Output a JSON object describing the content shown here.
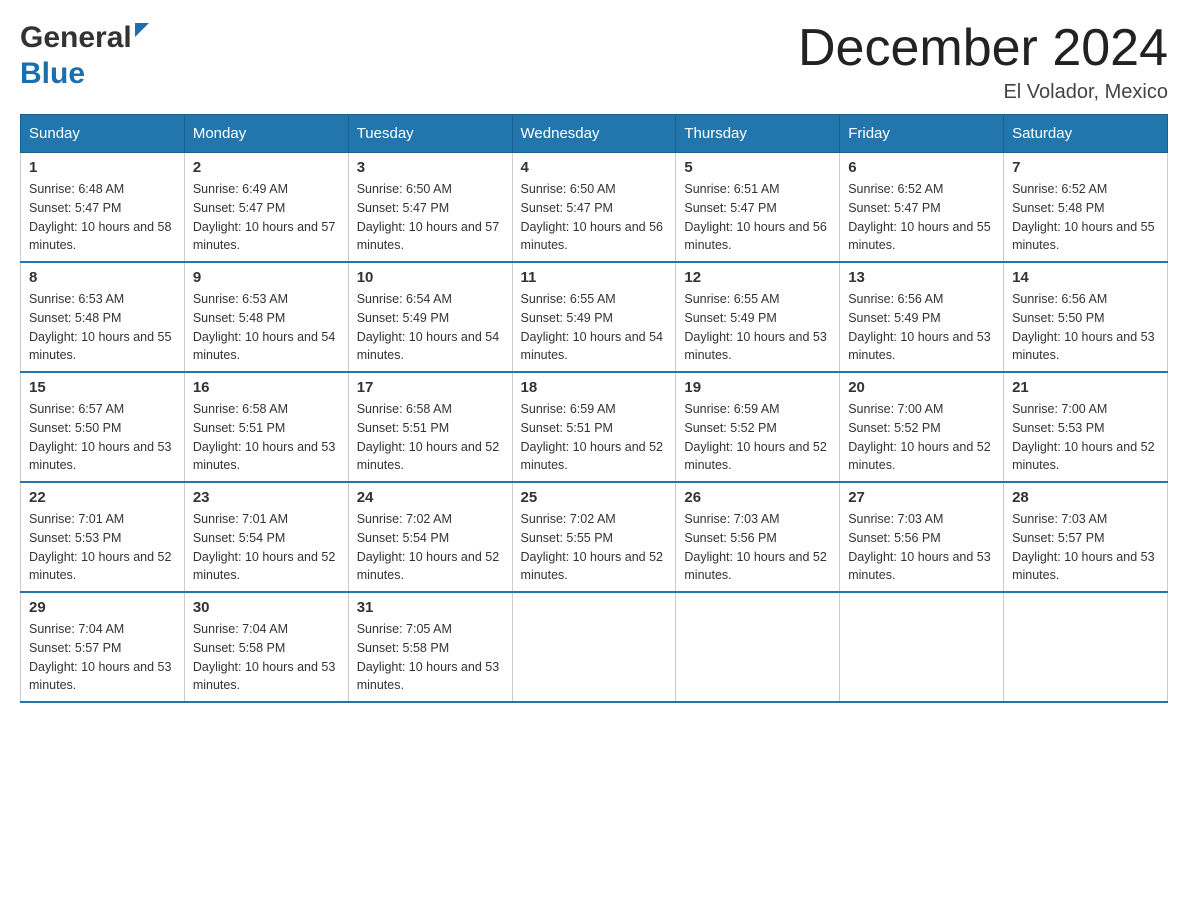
{
  "logo": {
    "line1": "General",
    "line2": "Blue"
  },
  "title": "December 2024",
  "location": "El Volador, Mexico",
  "weekdays": [
    "Sunday",
    "Monday",
    "Tuesday",
    "Wednesday",
    "Thursday",
    "Friday",
    "Saturday"
  ],
  "weeks": [
    [
      {
        "day": "1",
        "sunrise": "6:48 AM",
        "sunset": "5:47 PM",
        "daylight": "10 hours and 58 minutes."
      },
      {
        "day": "2",
        "sunrise": "6:49 AM",
        "sunset": "5:47 PM",
        "daylight": "10 hours and 57 minutes."
      },
      {
        "day": "3",
        "sunrise": "6:50 AM",
        "sunset": "5:47 PM",
        "daylight": "10 hours and 57 minutes."
      },
      {
        "day": "4",
        "sunrise": "6:50 AM",
        "sunset": "5:47 PM",
        "daylight": "10 hours and 56 minutes."
      },
      {
        "day": "5",
        "sunrise": "6:51 AM",
        "sunset": "5:47 PM",
        "daylight": "10 hours and 56 minutes."
      },
      {
        "day": "6",
        "sunrise": "6:52 AM",
        "sunset": "5:47 PM",
        "daylight": "10 hours and 55 minutes."
      },
      {
        "day": "7",
        "sunrise": "6:52 AM",
        "sunset": "5:48 PM",
        "daylight": "10 hours and 55 minutes."
      }
    ],
    [
      {
        "day": "8",
        "sunrise": "6:53 AM",
        "sunset": "5:48 PM",
        "daylight": "10 hours and 55 minutes."
      },
      {
        "day": "9",
        "sunrise": "6:53 AM",
        "sunset": "5:48 PM",
        "daylight": "10 hours and 54 minutes."
      },
      {
        "day": "10",
        "sunrise": "6:54 AM",
        "sunset": "5:49 PM",
        "daylight": "10 hours and 54 minutes."
      },
      {
        "day": "11",
        "sunrise": "6:55 AM",
        "sunset": "5:49 PM",
        "daylight": "10 hours and 54 minutes."
      },
      {
        "day": "12",
        "sunrise": "6:55 AM",
        "sunset": "5:49 PM",
        "daylight": "10 hours and 53 minutes."
      },
      {
        "day": "13",
        "sunrise": "6:56 AM",
        "sunset": "5:49 PM",
        "daylight": "10 hours and 53 minutes."
      },
      {
        "day": "14",
        "sunrise": "6:56 AM",
        "sunset": "5:50 PM",
        "daylight": "10 hours and 53 minutes."
      }
    ],
    [
      {
        "day": "15",
        "sunrise": "6:57 AM",
        "sunset": "5:50 PM",
        "daylight": "10 hours and 53 minutes."
      },
      {
        "day": "16",
        "sunrise": "6:58 AM",
        "sunset": "5:51 PM",
        "daylight": "10 hours and 53 minutes."
      },
      {
        "day": "17",
        "sunrise": "6:58 AM",
        "sunset": "5:51 PM",
        "daylight": "10 hours and 52 minutes."
      },
      {
        "day": "18",
        "sunrise": "6:59 AM",
        "sunset": "5:51 PM",
        "daylight": "10 hours and 52 minutes."
      },
      {
        "day": "19",
        "sunrise": "6:59 AM",
        "sunset": "5:52 PM",
        "daylight": "10 hours and 52 minutes."
      },
      {
        "day": "20",
        "sunrise": "7:00 AM",
        "sunset": "5:52 PM",
        "daylight": "10 hours and 52 minutes."
      },
      {
        "day": "21",
        "sunrise": "7:00 AM",
        "sunset": "5:53 PM",
        "daylight": "10 hours and 52 minutes."
      }
    ],
    [
      {
        "day": "22",
        "sunrise": "7:01 AM",
        "sunset": "5:53 PM",
        "daylight": "10 hours and 52 minutes."
      },
      {
        "day": "23",
        "sunrise": "7:01 AM",
        "sunset": "5:54 PM",
        "daylight": "10 hours and 52 minutes."
      },
      {
        "day": "24",
        "sunrise": "7:02 AM",
        "sunset": "5:54 PM",
        "daylight": "10 hours and 52 minutes."
      },
      {
        "day": "25",
        "sunrise": "7:02 AM",
        "sunset": "5:55 PM",
        "daylight": "10 hours and 52 minutes."
      },
      {
        "day": "26",
        "sunrise": "7:03 AM",
        "sunset": "5:56 PM",
        "daylight": "10 hours and 52 minutes."
      },
      {
        "day": "27",
        "sunrise": "7:03 AM",
        "sunset": "5:56 PM",
        "daylight": "10 hours and 53 minutes."
      },
      {
        "day": "28",
        "sunrise": "7:03 AM",
        "sunset": "5:57 PM",
        "daylight": "10 hours and 53 minutes."
      }
    ],
    [
      {
        "day": "29",
        "sunrise": "7:04 AM",
        "sunset": "5:57 PM",
        "daylight": "10 hours and 53 minutes."
      },
      {
        "day": "30",
        "sunrise": "7:04 AM",
        "sunset": "5:58 PM",
        "daylight": "10 hours and 53 minutes."
      },
      {
        "day": "31",
        "sunrise": "7:05 AM",
        "sunset": "5:58 PM",
        "daylight": "10 hours and 53 minutes."
      },
      null,
      null,
      null,
      null
    ]
  ]
}
